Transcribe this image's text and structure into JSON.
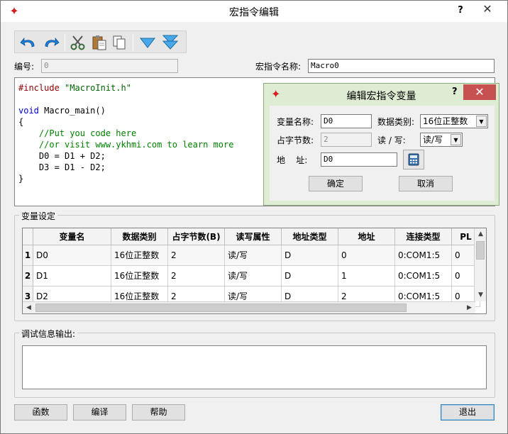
{
  "window": {
    "title": "宏指令编辑",
    "help": "?",
    "close": "✕"
  },
  "toolbar": {
    "icons": [
      "undo-icon",
      "redo-icon",
      "cut-icon",
      "paste-icon",
      "copy-icon",
      "move-down-icon",
      "move-bottom-icon"
    ]
  },
  "fields": {
    "number_label": "编号:",
    "number_value": "0",
    "name_label": "宏指令名称:",
    "name_value": "Macro0"
  },
  "code": {
    "lines": [
      {
        "parts": [
          {
            "cls": "kw-inc",
            "text": "#include"
          },
          {
            "cls": "",
            "text": " "
          },
          {
            "cls": "str",
            "text": "\"MacroInit.h\""
          }
        ]
      },
      {
        "parts": []
      },
      {
        "parts": [
          {
            "cls": "kw",
            "text": "void"
          },
          {
            "cls": "",
            "text": " Macro_main()"
          }
        ]
      },
      {
        "parts": [
          {
            "cls": "",
            "text": "{"
          }
        ]
      },
      {
        "parts": [
          {
            "cls": "cmt",
            "text": "    //Put you code here"
          }
        ]
      },
      {
        "parts": [
          {
            "cls": "cmt",
            "text": "    //or visit www.ykhmi.com to learn more"
          }
        ]
      },
      {
        "parts": [
          {
            "cls": "",
            "text": "    D0 = D1 + D2;"
          }
        ]
      },
      {
        "parts": [
          {
            "cls": "",
            "text": "    D3 = D1 - D2;"
          }
        ]
      },
      {
        "parts": [
          {
            "cls": "",
            "text": "}"
          }
        ]
      }
    ]
  },
  "variables": {
    "group_title": "变量设定",
    "headers": [
      "变量名",
      "数据类别",
      "占字节数(B)",
      "读写属性",
      "地址类型",
      "地址",
      "连接类型",
      "PL"
    ],
    "rows": [
      {
        "index": "1",
        "cells": [
          "D0",
          "16位正整数",
          "2",
          "读/写",
          "D",
          "0",
          "0:COM1:5",
          "0"
        ]
      },
      {
        "index": "2",
        "cells": [
          "D1",
          "16位正整数",
          "2",
          "读/写",
          "D",
          "1",
          "0:COM1:5",
          "0"
        ]
      },
      {
        "index": "3",
        "cells": [
          "D2",
          "16位正整数",
          "2",
          "读/写",
          "D",
          "2",
          "0:COM1:5",
          "0"
        ]
      }
    ]
  },
  "debug": {
    "group_title": "调试信息输出:"
  },
  "buttons": {
    "function": "函数",
    "compile": "编译",
    "help": "帮助",
    "exit": "退出"
  },
  "popup": {
    "title": "编辑宏指令变量",
    "help": "?",
    "close": "✕",
    "var_name_label": "变量名称:",
    "var_name_value": "D0",
    "data_type_label": "数据类别:",
    "data_type_value": "16位正整数",
    "bytes_label": "占字节数:",
    "bytes_value": "2",
    "rw_label": "读 / 写:",
    "rw_value": "读/写",
    "addr_label": "地    址:",
    "addr_value": "D0",
    "ok": "确定",
    "cancel": "取消"
  }
}
